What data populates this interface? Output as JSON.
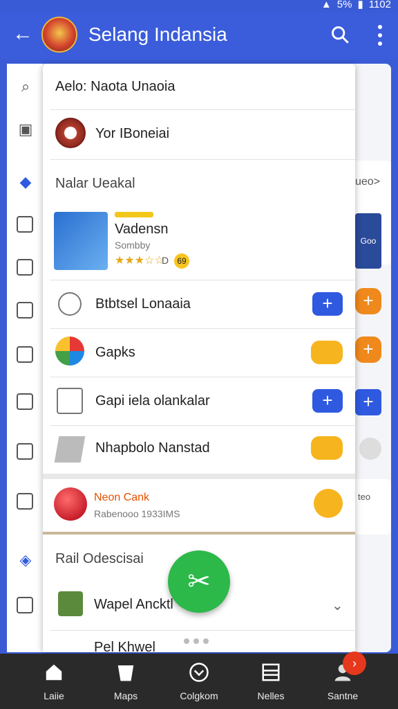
{
  "statusbar": {
    "battery": "5%",
    "time": "1102"
  },
  "appbar": {
    "title": "Selang Indansia"
  },
  "overlay": {
    "search_row": "Aelo: Naota Unaoia",
    "account_row": "Yor IBoneiai",
    "section1_header": "Nalar Ueakal",
    "featured": {
      "badge": "Vadensn",
      "title": "Vadensn",
      "subtitle": "Sombby",
      "rating_text": "D",
      "rating_score": "69"
    },
    "items": [
      {
        "label": "Btbtsel Lonaaia"
      },
      {
        "label": "Gapks"
      },
      {
        "label": "Gapi iela olankalar"
      },
      {
        "label": "Nhapbolo Nanstad"
      }
    ],
    "promo": {
      "title": "Neon Cank",
      "subtitle": "Rabenooo 1933IMS"
    },
    "section2_header": "Rail Odescisai",
    "list_rows": [
      "Wapel Ancktl",
      "Pel Khwel"
    ]
  },
  "right_strip": {
    "top_label": "ueo>",
    "card_text": "Goo",
    "lower_text": "teo"
  },
  "bottomnav": {
    "items": [
      {
        "label": "Laiie",
        "icon": "home-icon"
      },
      {
        "label": "Maps",
        "icon": "bucket-icon"
      },
      {
        "label": "Colgkom",
        "icon": "chevron-circle-icon"
      },
      {
        "label": "Nelles",
        "icon": "list-icon"
      },
      {
        "label": "Santne",
        "icon": "person-icon"
      }
    ]
  }
}
